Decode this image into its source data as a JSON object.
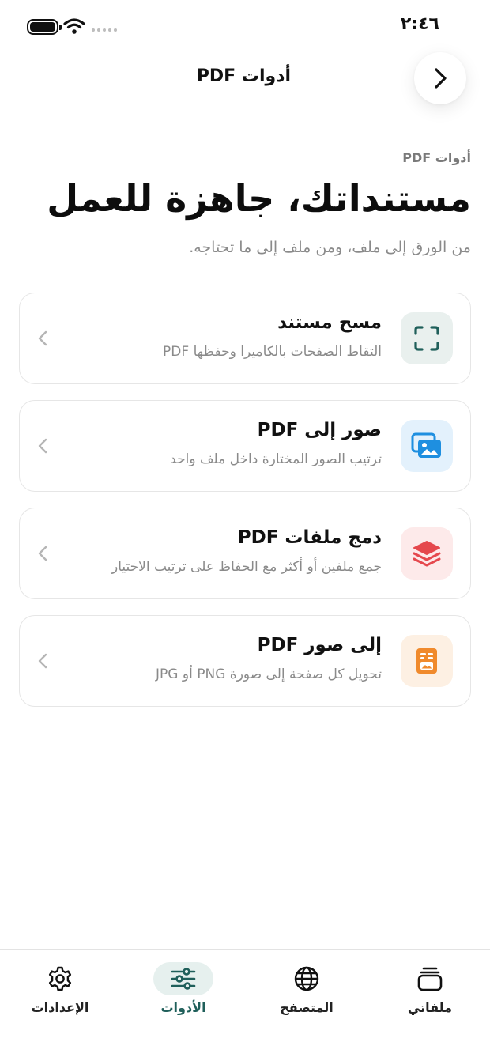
{
  "status_bar": {
    "time": "٢:٤٦",
    "icons": [
      "battery-icon",
      "wifi-icon",
      "signal-icon"
    ]
  },
  "header": {
    "title": "أدوات PDF",
    "back_icon": "chevron-right-icon"
  },
  "intro": {
    "eyebrow": "أدوات PDF",
    "title": "مستنداتك، جاهزة للعمل",
    "subtitle": "من الورق إلى ملف، ومن ملف إلى ما تحتاجه."
  },
  "tools": [
    {
      "title": "مسح مستند",
      "description": "التقاط الصفحات بالكاميرا وحفظها PDF",
      "icon": "scan-icon",
      "icon_color": "#1f5f5a",
      "icon_bg": "#e9f0ee"
    },
    {
      "title": "صور إلى PDF",
      "description": "ترتيب الصور المختارة داخل ملف واحد",
      "icon": "images-icon",
      "icon_color": "#1e8fe0",
      "icon_bg": "#e3f1fc"
    },
    {
      "title": "دمج ملفات PDF",
      "description": "جمع ملفين أو أكثر مع الحفاظ على ترتيب الاختيار",
      "icon": "layers-icon",
      "icon_color": "#e5484d",
      "icon_bg": "#fdeaea"
    },
    {
      "title": "إلى صور PDF",
      "description": "تحويل كل صفحة إلى صورة PNG أو JPG",
      "icon": "file-image-icon",
      "icon_color": "#f08a2c",
      "icon_bg": "#fdf0e3"
    }
  ],
  "bottom_nav": {
    "items": [
      {
        "label": "ملفاتي",
        "icon": "files-stack-icon",
        "active": false
      },
      {
        "label": "المتصفح",
        "icon": "globe-icon",
        "active": false
      },
      {
        "label": "الأدوات",
        "icon": "sliders-icon",
        "active": true
      },
      {
        "label": "الإعدادات",
        "icon": "gear-icon",
        "active": false
      }
    ],
    "active_color": "#1f5f5a",
    "active_bg": "#e6f0ee"
  }
}
